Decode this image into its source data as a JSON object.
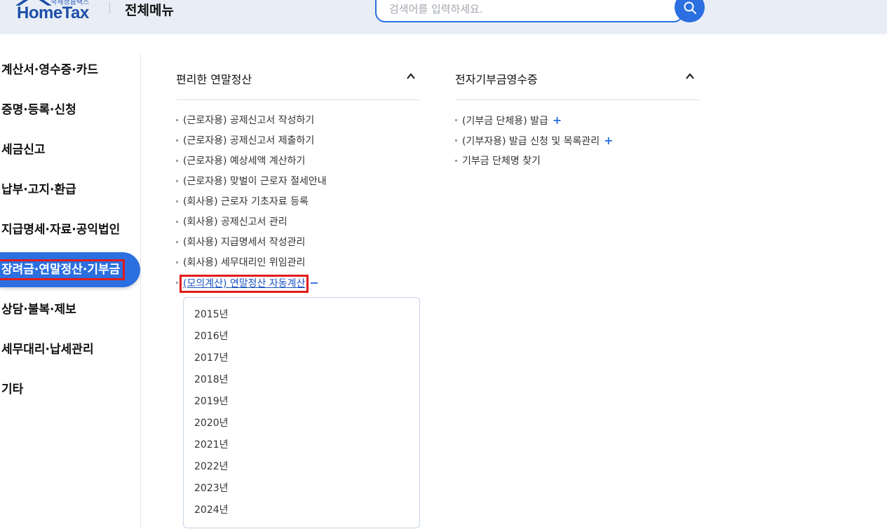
{
  "header": {
    "logo_sub": "국세청홈택스",
    "logo_main": "HomeTax",
    "title": "전체메뉴",
    "search_placeholder": "검색어를 입력하세요."
  },
  "left_nav": {
    "items": [
      {
        "label": "계산서·영수증·카드"
      },
      {
        "label": "증명·등록·신청"
      },
      {
        "label": "세금신고"
      },
      {
        "label": "납부·고지·환급"
      },
      {
        "label": "지급명세·자료·공익법인"
      },
      {
        "label": "장려금·연말정산·기부금",
        "active": true
      },
      {
        "label": "상담·불복·제보"
      },
      {
        "label": "세무대리·납세관리"
      },
      {
        "label": "기타"
      }
    ]
  },
  "col1": {
    "title": "편리한 연말정산",
    "items": [
      {
        "label": "(근로자용) 공제신고서 작성하기"
      },
      {
        "label": "(근로자용) 공제신고서 제출하기"
      },
      {
        "label": "(근로자용) 예상세액 계산하기"
      },
      {
        "label": "(근로자용) 맞벌이 근로자 절세안내"
      },
      {
        "label": "(회사용) 근로자 기초자료 등록"
      },
      {
        "label": "(회사용) 공제신고서 관리"
      },
      {
        "label": "(회사용) 지급명세서 작성관리"
      },
      {
        "label": "(회사용) 세무대리인 위임관리"
      },
      {
        "label": "(모의계산) 연말정산 자동계산"
      }
    ],
    "years": [
      "2015년",
      "2016년",
      "2017년",
      "2018년",
      "2019년",
      "2020년",
      "2021년",
      "2022년",
      "2023년",
      "2024년"
    ]
  },
  "col2": {
    "title": "전자기부금영수증",
    "items": [
      {
        "label": "(기부금 단체용) 발급",
        "expand": "+"
      },
      {
        "label": "(기부자용) 발급 신청 및 목록관리",
        "expand": "+"
      },
      {
        "label": "기부금 단체명 찾기"
      }
    ]
  },
  "symbols": {
    "expand": "+",
    "collapse": "−"
  },
  "icons": {
    "search": "search-icon",
    "collapse": "chevron-up-icon",
    "logo": "house-roof-icon"
  },
  "colors": {
    "accent": "#2b6fe0",
    "highlight": "#e01c1c",
    "header_bg": "#e9eef6"
  }
}
